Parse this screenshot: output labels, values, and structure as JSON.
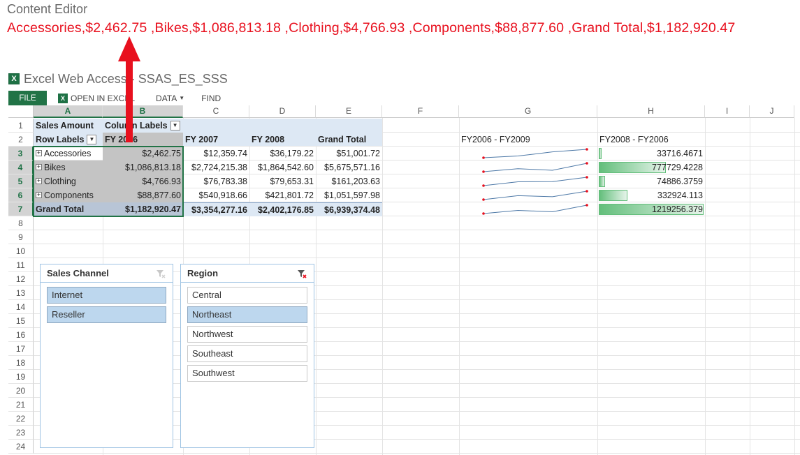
{
  "content_editor": {
    "title": "Content Editor",
    "text": "Accessories,$2,462.75 ,Bikes,$1,086,813.18 ,Clothing,$4,766.93 ,Components,$88,877.60 ,Grand Total,$1,182,920.47"
  },
  "web_part": {
    "icon_letter": "X",
    "title": "Excel Web Access - SSAS_ES_SSS"
  },
  "ribbon": {
    "file": "FILE",
    "open_in_excel": "OPEN IN EXCEL",
    "data": "DATA",
    "find": "FIND"
  },
  "columns": [
    "A",
    "B",
    "C",
    "D",
    "E",
    "F",
    "G",
    "H",
    "I",
    "J"
  ],
  "rows": [
    "1",
    "2",
    "3",
    "4",
    "5",
    "6",
    "7",
    "8",
    "9",
    "10",
    "11",
    "12",
    "13",
    "14",
    "15",
    "16",
    "17",
    "18",
    "19",
    "20",
    "21",
    "22",
    "23",
    "24"
  ],
  "pivot": {
    "sales_amount": "Sales Amount",
    "column_labels": "Column Labels",
    "row_labels": "Row Labels",
    "headers": [
      "FY 2006",
      "FY 2007",
      "FY 2008",
      "Grand Total"
    ],
    "rows": [
      {
        "label": "Accessories",
        "values": [
          "$2,462.75",
          "$12,359.74",
          "$36,179.22",
          "$51,001.72"
        ]
      },
      {
        "label": "Bikes",
        "values": [
          "$1,086,813.18",
          "$2,724,215.38",
          "$1,864,542.60",
          "$5,675,571.16"
        ]
      },
      {
        "label": "Clothing",
        "values": [
          "$4,766.93",
          "$76,783.38",
          "$79,653.31",
          "$161,203.63"
        ]
      },
      {
        "label": "Components",
        "values": [
          "$88,877.60",
          "$540,918.66",
          "$421,801.72",
          "$1,051,597.98"
        ]
      }
    ],
    "grand_total": {
      "label": "Grand Total",
      "values": [
        "$1,182,920.47",
        "$3,354,277.16",
        "$2,402,176.85",
        "$6,939,374.48"
      ]
    }
  },
  "sparklines": {
    "header": "FY2006 - FY2009",
    "color": "#4e79a7",
    "marker_color": "#e8101e",
    "series": [
      [
        2462.75,
        12359.74,
        36179.22,
        51001.72
      ],
      [
        1086813.18,
        2724215.38,
        1864542.6,
        5675571.16
      ],
      [
        4766.93,
        76783.38,
        79653.31,
        161203.63
      ],
      [
        88877.6,
        540918.66,
        421801.72,
        1051597.98
      ],
      [
        1182920.47,
        3354277.16,
        2402176.85,
        6939374.48
      ]
    ]
  },
  "databars": {
    "header": "FY2008 - FY2006",
    "color": "#63be7b",
    "max": 1219256.379,
    "values": [
      "33716.4671",
      "777729.4228",
      "74886.3759",
      "332924.113",
      "1219256.379"
    ]
  },
  "slicers": {
    "sales_channel": {
      "title": "Sales Channel",
      "items": [
        "Internet",
        "Reseller"
      ],
      "selected": [
        "Internet",
        "Reseller"
      ]
    },
    "region": {
      "title": "Region",
      "items": [
        "Central",
        "Northeast",
        "Northwest",
        "Southeast",
        "Southwest"
      ],
      "selected": [
        "Northeast"
      ]
    }
  },
  "annotation_color": "#e8101e"
}
